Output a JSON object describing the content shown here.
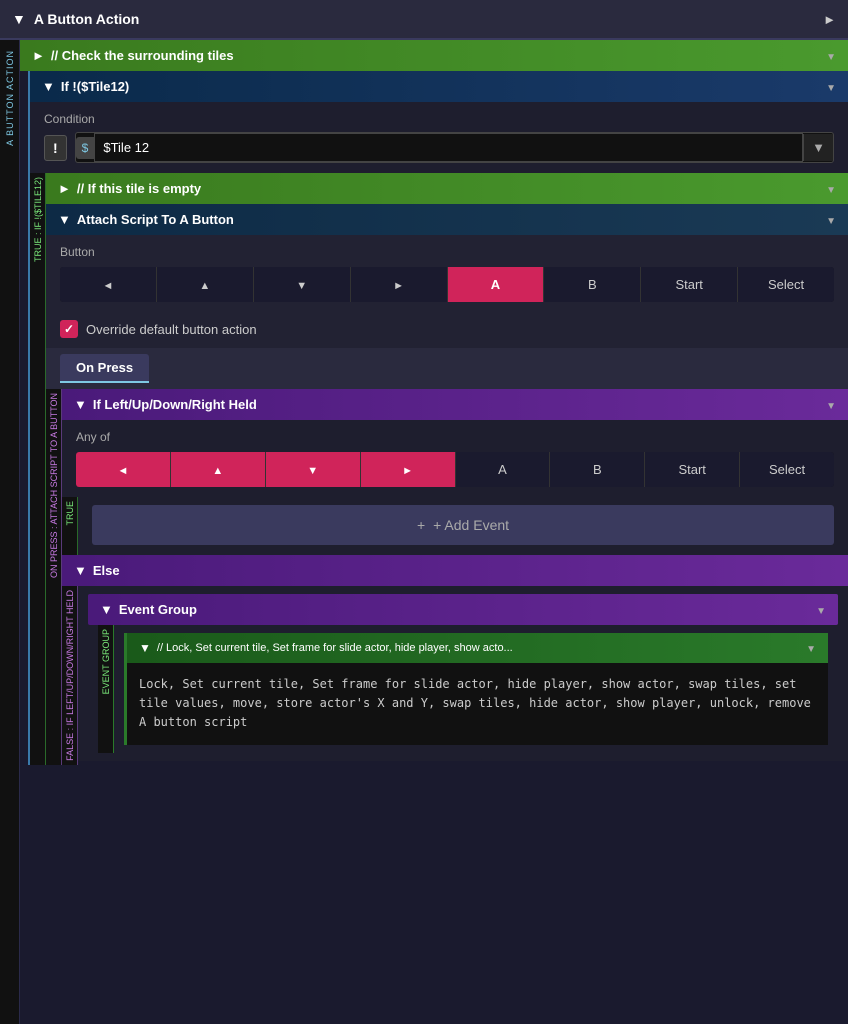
{
  "header": {
    "title": "A Button Action",
    "collapse_icon": "▼",
    "expand_icon": "►"
  },
  "sidebar_label": "A BUTTON ACTION",
  "sections": {
    "check_tiles": {
      "label": "// Check the surrounding tiles",
      "prefix": "►"
    },
    "if_tile12": {
      "label": "If !($Tile12)",
      "prefix": "▼"
    },
    "condition": {
      "label": "Condition",
      "not_symbol": "!",
      "dollar_symbol": "$",
      "value": "$Tile 12"
    },
    "if_tile_empty": {
      "label": "// If this tile is empty",
      "prefix": "►"
    },
    "attach_script": {
      "label": "Attach Script To A Button",
      "prefix": "▼"
    },
    "button_label": "Button",
    "buttons": [
      "◄",
      "▲",
      "▼",
      "►",
      "A",
      "B",
      "Start",
      "Select"
    ],
    "active_button": 4,
    "override_label": "Override default button action",
    "on_press_tab": "On Press",
    "if_held": {
      "label": "If Left/Up/Down/Right Held",
      "prefix": "▼"
    },
    "any_of_label": "Any of",
    "any_of_buttons": [
      "◄",
      "▲",
      "▼",
      "►",
      "A",
      "B",
      "Start",
      "Select"
    ],
    "active_any_of": [
      0,
      1,
      2,
      3
    ],
    "add_event_label": "+ Add Event",
    "else_label": "Else",
    "event_group_label": "Event Group",
    "lock_label": "// Lock, Set current tile, Set frame for slide actor, hide player, show acto...",
    "lock_content": "Lock, Set current tile, Set frame for slide actor, hide\nplayer, show actor, swap tiles, set tile values, move, store\nactor's X and Y, swap tiles, hide actor, show player, unlock,\nremove A button script"
  }
}
